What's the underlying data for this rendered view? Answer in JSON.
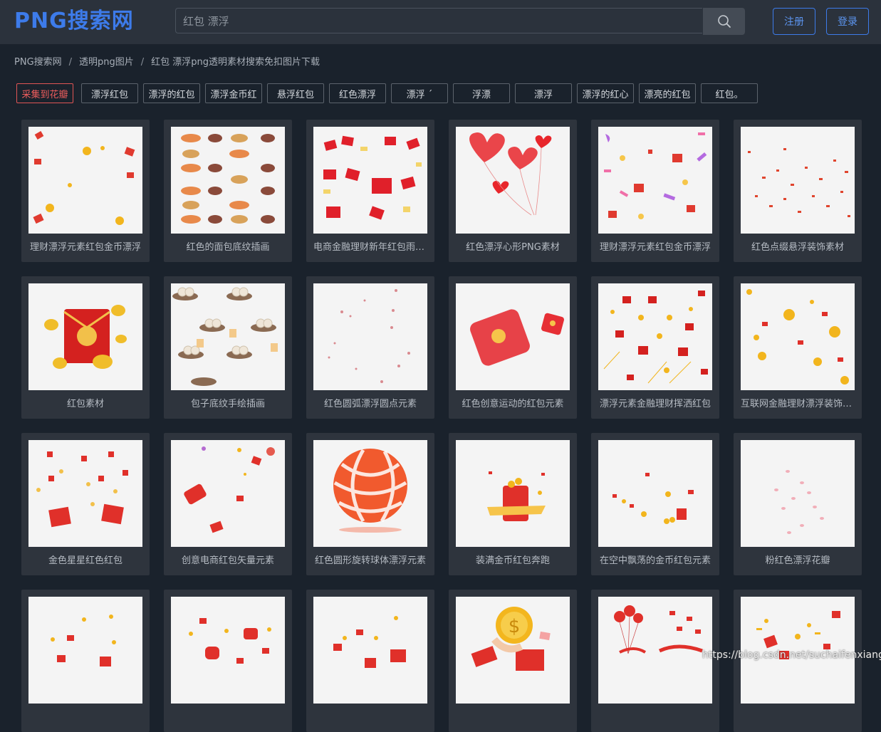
{
  "header": {
    "logo_text": "PNG搜索网",
    "search_value": "红包 漂浮",
    "register_label": "注册",
    "login_label": "登录",
    "accent_color": "#3d7bea"
  },
  "breadcrumb": [
    "PNG搜索网",
    "透明png图片",
    "红包 漂浮png透明素材搜索免扣图片下载"
  ],
  "tags": {
    "collect_label": "采集到花瓣",
    "items": [
      "漂浮红包",
      "漂浮的红包",
      "漂浮金币红",
      "悬浮红包",
      "红色漂浮",
      "漂浮 ´",
      "浮漂",
      "漂浮",
      "漂浮的红心",
      "漂亮的红包",
      "红包。"
    ]
  },
  "cards": [
    {
      "caption": "理财漂浮元素红包金币漂浮"
    },
    {
      "caption": "红色的面包底纹插画"
    },
    {
      "caption": "电商金融理财新年红包雨漂浮"
    },
    {
      "caption": "红色漂浮心形PNG素材"
    },
    {
      "caption": "理财漂浮元素红包金币漂浮"
    },
    {
      "caption": "红色点缀悬浮装饰素材"
    },
    {
      "caption": "红包素材"
    },
    {
      "caption": "包子底纹手绘插画"
    },
    {
      "caption": "红色圆弧漂浮圆点元素"
    },
    {
      "caption": "红色创意运动的红包元素"
    },
    {
      "caption": "漂浮元素金融理财挥洒红包"
    },
    {
      "caption": "互联网金融理财漂浮装饰元素"
    },
    {
      "caption": "金色星星红色红包"
    },
    {
      "caption": "创意电商红包矢量元素"
    },
    {
      "caption": "红色圆形旋转球体漂浮元素"
    },
    {
      "caption": "装满金币红包奔跑"
    },
    {
      "caption": "在空中飘荡的金币红包元素"
    },
    {
      "caption": "粉红色漂浮花瓣"
    },
    {
      "caption": ""
    },
    {
      "caption": ""
    },
    {
      "caption": ""
    },
    {
      "caption": ""
    },
    {
      "caption": ""
    },
    {
      "caption": ""
    }
  ],
  "watermark": "https://blog.csdn.net/suchaifenxiang"
}
